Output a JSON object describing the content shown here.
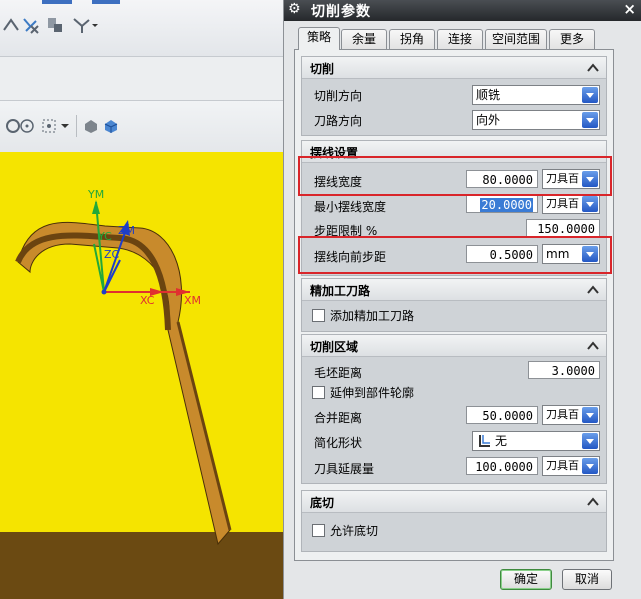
{
  "dialog": {
    "title": "切削参数",
    "tabs": [
      {
        "label": "策略",
        "active": true
      },
      {
        "label": "余量",
        "active": false
      },
      {
        "label": "拐角",
        "active": false
      },
      {
        "label": "连接",
        "active": false
      },
      {
        "label": "空间范围",
        "active": false
      },
      {
        "label": "更多",
        "active": false
      }
    ],
    "sections": {
      "cut": {
        "title": "切削",
        "cut_direction": {
          "label": "切削方向",
          "value": "顺铣"
        },
        "tool_path_direction": {
          "label": "刀路方向",
          "value": "向外"
        }
      },
      "trochoid": {
        "title": "摆线设置",
        "width": {
          "label": "摆线宽度",
          "value": "80.0000",
          "unit": "刀具百"
        },
        "min_width": {
          "label": "最小摆线宽度",
          "value": "20.0000",
          "unit": "刀具百"
        },
        "step_limit": {
          "label": "步距限制 %",
          "value": "150.0000"
        },
        "forward_step": {
          "label": "摆线向前步距",
          "value": "0.5000",
          "unit": "mm"
        }
      },
      "finish": {
        "title": "精加工刀路",
        "add_finish": {
          "label": "添加精加工刀路",
          "checked": false
        }
      },
      "cut_region": {
        "title": "切削区域",
        "blank_distance": {
          "label": "毛坯距离",
          "value": "3.0000"
        },
        "extend_to_part": {
          "label": "延伸到部件轮廓",
          "checked": false
        },
        "merge_distance": {
          "label": "合并距离",
          "value": "50.0000",
          "unit": "刀具百"
        },
        "simplify_shape": {
          "label": "简化形状",
          "value": "无"
        },
        "tool_extension": {
          "label": "刀具延展量",
          "value": "100.0000",
          "unit": "刀具百"
        }
      },
      "undercut": {
        "title": "底切",
        "allow_undercut": {
          "label": "允许底切",
          "checked": false
        }
      }
    },
    "buttons": {
      "ok": "确定",
      "cancel": "取消"
    }
  },
  "viewport": {
    "axes": {
      "ym": "YM",
      "yc": "YC",
      "zm": "ZM",
      "zc": "ZC",
      "xc": "XC",
      "xm": "XM"
    },
    "colors": {
      "background": "#f5e400",
      "part_top": "#8a5a16",
      "part_face": "#c88a2c",
      "axis_x": "#e03030",
      "axis_y": "#22a83a",
      "axis_z": "#1e3ec8"
    }
  }
}
